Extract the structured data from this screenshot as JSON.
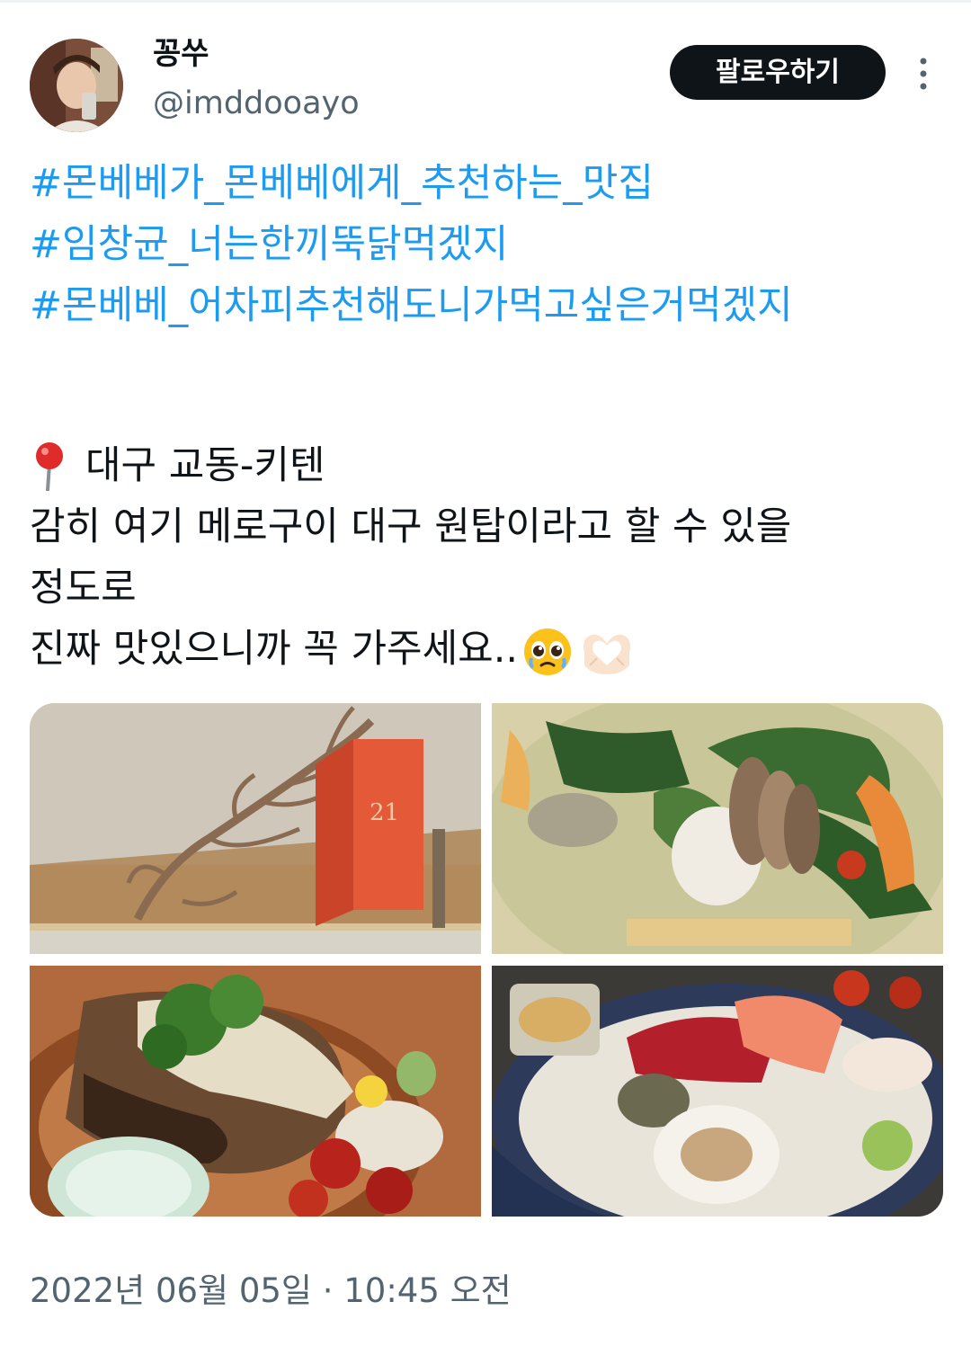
{
  "author": {
    "display_name": "꽁쑤",
    "handle": "@imddooayo",
    "avatar_icon": "profile-photo"
  },
  "follow_button": {
    "label": "팔로우하기"
  },
  "more_menu": {
    "icon": "more-vertical-icon"
  },
  "tweet": {
    "hashtags": [
      "#몬베베가_몬베베에게_추천하는_맛집",
      "#임창균_너는한끼뚝닭먹겠지",
      "#몬베베_어차피추천해도니가먹고싶은거먹겠지"
    ],
    "location_text": "대구 교동-키텐",
    "body_lines": [
      "감히 여기 메로구이 대구 원탑이라고 할 수 있을",
      "정도로",
      "진짜 맛있으니까 꼭 가주세요.."
    ],
    "pin_icon": "round-pushpin-emoji",
    "trailing_emojis": [
      "pleading-face-emoji",
      "heart-hands-emoji"
    ]
  },
  "media": {
    "photos": [
      {
        "name": "photo-branch-decor-red-box",
        "box_label": "21"
      },
      {
        "name": "photo-soup-with-greens"
      },
      {
        "name": "photo-grilled-fish"
      },
      {
        "name": "photo-sashimi-platter"
      }
    ]
  },
  "timestamp": {
    "text": "2022년 06월 05일 · 10:45 오전"
  },
  "colors": {
    "hashtag": "#1d9bf0",
    "text": "#0f1419",
    "secondary": "#536471",
    "button_bg": "#0f1419"
  }
}
